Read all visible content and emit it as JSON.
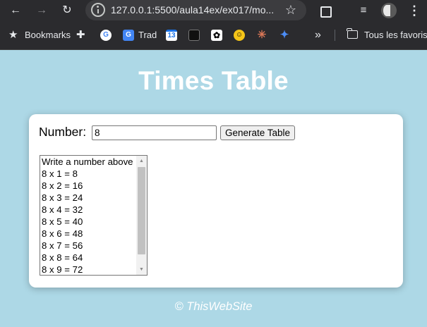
{
  "browser": {
    "url": "127.0.0.1:5500/aula14ex/ex017/mo...",
    "icons": [
      "back-icon",
      "forward-icon",
      "reload-icon",
      "site-info-icon",
      "star-icon",
      "extensions-icon",
      "media-icon",
      "profile-icon",
      "menu-icon"
    ]
  },
  "bookmarks_bar": {
    "bookmarks_label": "Bookmarks",
    "trad_label": "Trad",
    "calendar_day": "13",
    "overflow_label": "»",
    "all_bookmarks_label": "Tous les favoris"
  },
  "page": {
    "title": "Times Table",
    "number_label": "Number:",
    "number_value": "8",
    "generate_button": "Generate Table",
    "results": [
      "Write a number above",
      "8 x 1 = 8",
      "8 x 2 = 16",
      "8 x 3 = 24",
      "8 x 4 = 32",
      "8 x 5 = 40",
      "8 x 6 = 48",
      "8 x 7 = 56",
      "8 x 8 = 64",
      "8 x 9 = 72"
    ],
    "footer": "© ThisWebSite"
  },
  "colors": {
    "page_background": "#add8e6",
    "card_background": "#ffffff",
    "title_color": "#ffffff",
    "browser_chrome": "#2b2b2e"
  }
}
